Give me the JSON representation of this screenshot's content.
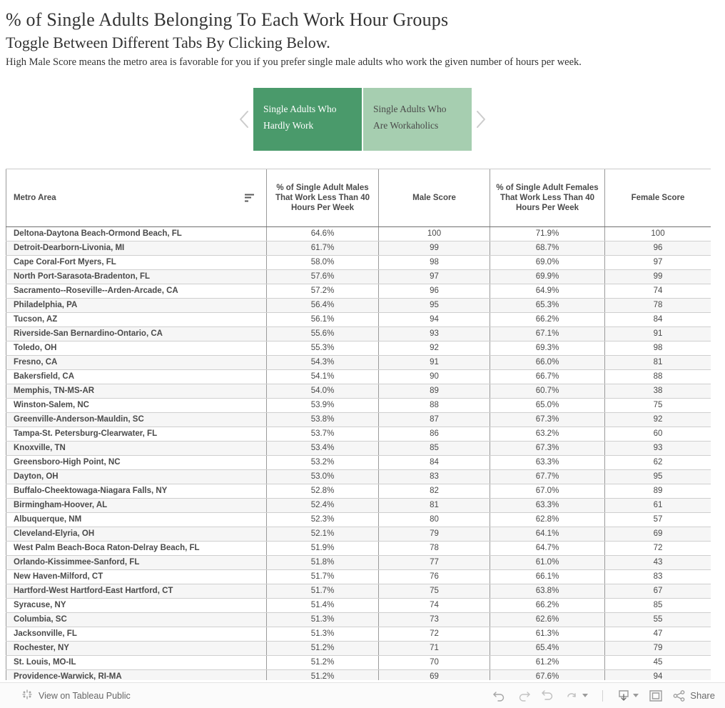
{
  "header": {
    "title": "% of Single Adults Belonging To Each Work Hour Groups",
    "subtitle": "Toggle Between Different Tabs By Clicking Below.",
    "note": "High Male Score means the metro area is favorable for you if you prefer single male adults who work the given number of hours per week."
  },
  "tabs": {
    "prev_icon": "chevron-left-icon",
    "next_icon": "chevron-right-icon",
    "items": [
      {
        "label": "Single Adults Who Hardly Work",
        "active": true
      },
      {
        "label": "Single Adults Who Are Workaholics",
        "active": false
      }
    ],
    "active_color": "#4a9a6b",
    "inactive_color": "#a6ceb0"
  },
  "table": {
    "sort_icon": "sort-icon",
    "columns": [
      "Metro Area",
      "% of Single Adult Males That Work Less Than 40 Hours Per Week",
      "Male Score",
      "% of Single Adult Females That Work Less Than 40 Hours Per Week",
      "Female Score"
    ],
    "rows": [
      [
        "Deltona-Daytona Beach-Ormond Beach, FL",
        "64.6%",
        "100",
        "71.9%",
        "100"
      ],
      [
        "Detroit-Dearborn-Livonia, MI",
        "61.7%",
        "99",
        "68.7%",
        "96"
      ],
      [
        "Cape Coral-Fort Myers, FL",
        "58.0%",
        "98",
        "69.0%",
        "97"
      ],
      [
        "North Port-Sarasota-Bradenton, FL",
        "57.6%",
        "97",
        "69.9%",
        "99"
      ],
      [
        "Sacramento--Roseville--Arden-Arcade, CA",
        "57.2%",
        "96",
        "64.9%",
        "74"
      ],
      [
        "Philadelphia, PA",
        "56.4%",
        "95",
        "65.3%",
        "78"
      ],
      [
        "Tucson, AZ",
        "56.1%",
        "94",
        "66.2%",
        "84"
      ],
      [
        "Riverside-San Bernardino-Ontario, CA",
        "55.6%",
        "93",
        "67.1%",
        "91"
      ],
      [
        "Toledo, OH",
        "55.3%",
        "92",
        "69.3%",
        "98"
      ],
      [
        "Fresno, CA",
        "54.3%",
        "91",
        "66.0%",
        "81"
      ],
      [
        "Bakersfield, CA",
        "54.1%",
        "90",
        "66.7%",
        "88"
      ],
      [
        "Memphis, TN-MS-AR",
        "54.0%",
        "89",
        "60.7%",
        "38"
      ],
      [
        "Winston-Salem, NC",
        "53.9%",
        "88",
        "65.0%",
        "75"
      ],
      [
        "Greenville-Anderson-Mauldin, SC",
        "53.8%",
        "87",
        "67.3%",
        "92"
      ],
      [
        "Tampa-St. Petersburg-Clearwater, FL",
        "53.7%",
        "86",
        "63.2%",
        "60"
      ],
      [
        "Knoxville, TN",
        "53.4%",
        "85",
        "67.3%",
        "93"
      ],
      [
        "Greensboro-High Point, NC",
        "53.2%",
        "84",
        "63.3%",
        "62"
      ],
      [
        "Dayton, OH",
        "53.0%",
        "83",
        "67.7%",
        "95"
      ],
      [
        "Buffalo-Cheektowaga-Niagara Falls, NY",
        "52.8%",
        "82",
        "67.0%",
        "89"
      ],
      [
        "Birmingham-Hoover, AL",
        "52.4%",
        "81",
        "63.3%",
        "61"
      ],
      [
        "Albuquerque, NM",
        "52.3%",
        "80",
        "62.8%",
        "57"
      ],
      [
        "Cleveland-Elyria, OH",
        "52.1%",
        "79",
        "64.1%",
        "69"
      ],
      [
        "West Palm Beach-Boca Raton-Delray Beach, FL",
        "51.9%",
        "78",
        "64.7%",
        "72"
      ],
      [
        "Orlando-Kissimmee-Sanford, FL",
        "51.8%",
        "77",
        "61.0%",
        "43"
      ],
      [
        "New Haven-Milford, CT",
        "51.7%",
        "76",
        "66.1%",
        "83"
      ],
      [
        "Hartford-West Hartford-East Hartford, CT",
        "51.7%",
        "75",
        "63.8%",
        "67"
      ],
      [
        "Syracuse, NY",
        "51.4%",
        "74",
        "66.2%",
        "85"
      ],
      [
        "Columbia, SC",
        "51.3%",
        "73",
        "62.6%",
        "55"
      ],
      [
        "Jacksonville, FL",
        "51.3%",
        "72",
        "61.3%",
        "47"
      ],
      [
        "Rochester, NY",
        "51.2%",
        "71",
        "65.4%",
        "79"
      ],
      [
        "St. Louis, MO-IL",
        "51.2%",
        "70",
        "61.2%",
        "45"
      ],
      [
        "Providence-Warwick, RI-MA",
        "51.2%",
        "69",
        "67.6%",
        "94"
      ]
    ]
  },
  "toolbar": {
    "view_label": "View on Tableau Public",
    "tableau_icon": "tableau-logo-icon",
    "undo_icon": "undo-icon",
    "redo_icon": "redo-icon",
    "revert_icon": "revert-icon",
    "refresh_icon": "refresh-icon",
    "download_icon": "download-icon",
    "fullscreen_icon": "fullscreen-icon",
    "share_icon": "share-icon",
    "share_label": "Share"
  }
}
